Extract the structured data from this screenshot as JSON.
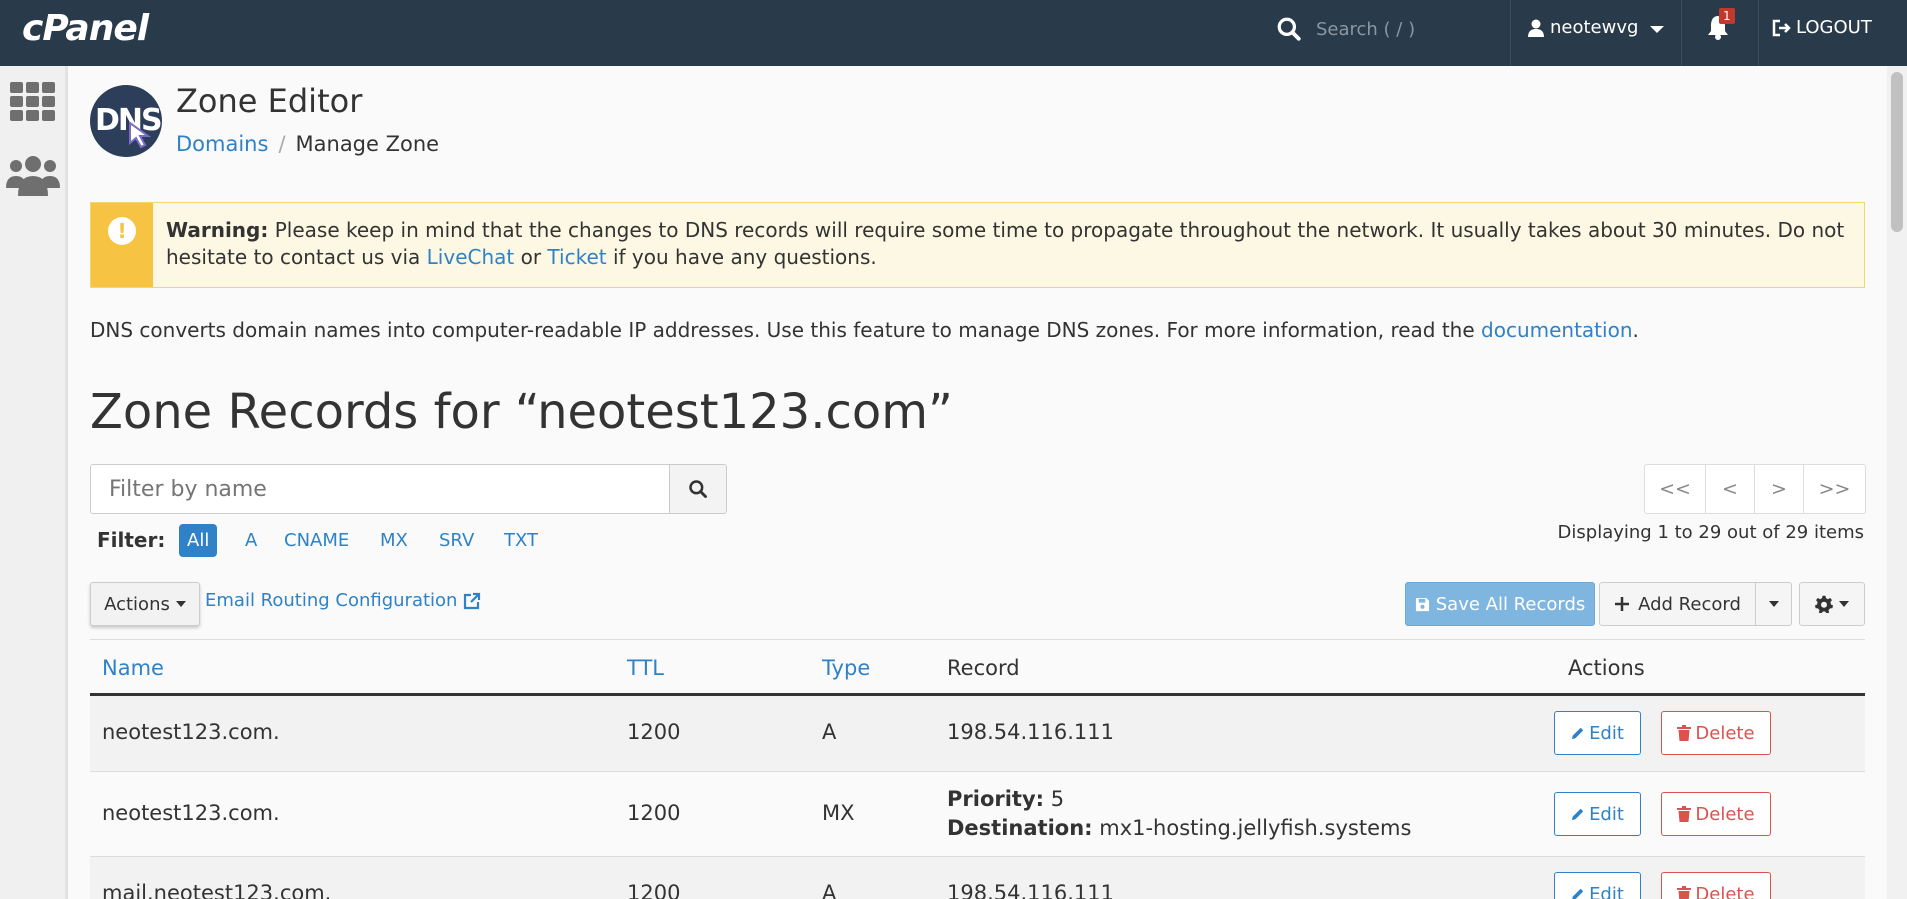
{
  "topbar": {
    "logo": "cPanel",
    "search_placeholder": "Search ( / )",
    "username": "neotewvg",
    "notification_count": "1",
    "logout_label": "LOGOUT"
  },
  "header": {
    "logo_text": "DNS",
    "title": "Zone Editor",
    "breadcrumb": [
      "Domains",
      "Manage Zone"
    ]
  },
  "warning": {
    "label": "Warning:",
    "text_before": " Please keep in mind that the changes to DNS records will require some time to propagate throughout the network. It usually takes about 30 minutes. Do not hesitate to contact us via ",
    "link_livechat": "LiveChat",
    "text_or": " or ",
    "link_ticket": "Ticket",
    "text_after": " if you have any questions."
  },
  "intro": {
    "text": "DNS converts domain names into computer-readable IP addresses. Use this feature to manage DNS zones. For more information, read the ",
    "link": "documentation",
    "end": "."
  },
  "zone_title": "Zone Records for “neotest123.com”",
  "filter": {
    "placeholder": "Filter by name",
    "label": "Filter:",
    "chips": [
      "All",
      "A",
      "CNAME",
      "MX",
      "SRV",
      "TXT"
    ],
    "active": "All"
  },
  "pager": [
    "<<",
    "<",
    ">",
    ">>"
  ],
  "displaying": "Displaying 1 to 29 out of 29 items",
  "toolbar": {
    "actions_label": "Actions",
    "email_routing": "Email Routing Configuration",
    "save_all": "Save All Records",
    "add_record": "Add Record"
  },
  "table": {
    "headers": [
      "Name",
      "TTL",
      "Type",
      "Record",
      "Actions"
    ],
    "edit_label": "Edit",
    "delete_label": "Delete",
    "rows": [
      {
        "name": "neotest123.com.",
        "ttl": "1200",
        "type": "A",
        "record": "198.54.116.111"
      },
      {
        "name": "neotest123.com.",
        "ttl": "1200",
        "type": "MX",
        "priority_label": "Priority:",
        "priority": "5",
        "destination_label": "Destination:",
        "destination": "mx1-hosting.jellyfish.systems"
      },
      {
        "name": "mail.neotest123.com.",
        "ttl": "1200",
        "type": "A",
        "record": "198.54.116.111"
      }
    ]
  },
  "colors": {
    "topbar": "#293a4a",
    "link": "#2f82c7",
    "warning_bg": "#fcf8e3",
    "warning_strip": "#f6c342",
    "delete": "#d9534f"
  }
}
